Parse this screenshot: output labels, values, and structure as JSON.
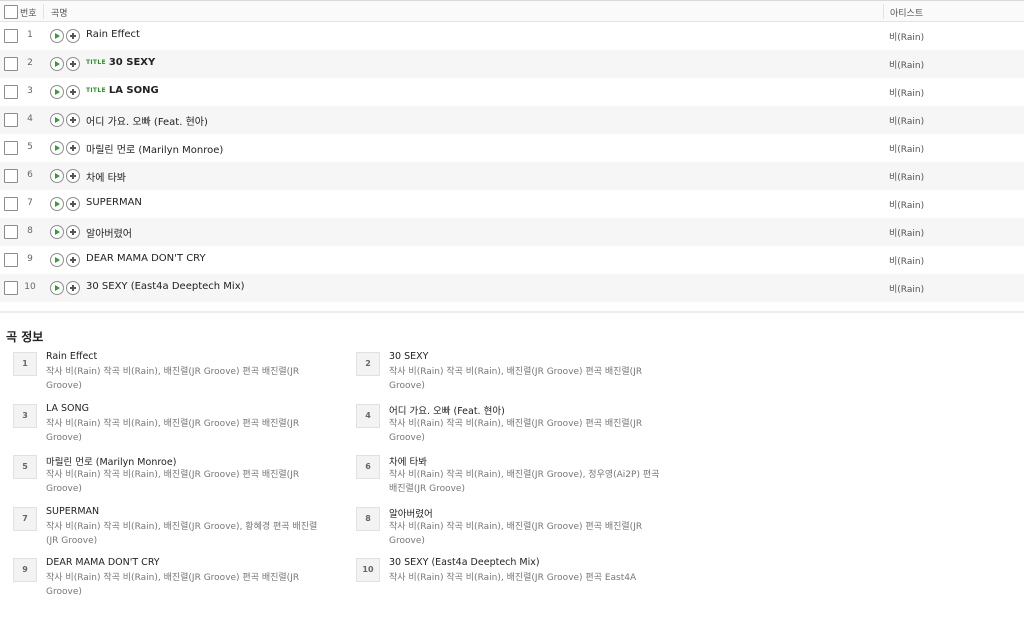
{
  "table": {
    "columns": {
      "number": "번호",
      "title": "곡명",
      "artist": "아티스트"
    },
    "title_badge": "TITLE",
    "tracks": [
      {
        "num": "1",
        "title": "Rain Effect",
        "artist": "비(Rain)",
        "is_title": false
      },
      {
        "num": "2",
        "title": "30 SEXY",
        "artist": "비(Rain)",
        "is_title": true
      },
      {
        "num": "3",
        "title": "LA SONG",
        "artist": "비(Rain)",
        "is_title": true
      },
      {
        "num": "4",
        "title": "어디 가요. 오빠 (Feat. 현아)",
        "artist": "비(Rain)",
        "is_title": false
      },
      {
        "num": "5",
        "title": "마릴린 먼로 (Marilyn Monroe)",
        "artist": "비(Rain)",
        "is_title": false
      },
      {
        "num": "6",
        "title": "차에 타봐",
        "artist": "비(Rain)",
        "is_title": false
      },
      {
        "num": "7",
        "title": "SUPERMAN",
        "artist": "비(Rain)",
        "is_title": false
      },
      {
        "num": "8",
        "title": "알아버렸어",
        "artist": "비(Rain)",
        "is_title": false
      },
      {
        "num": "9",
        "title": "DEAR MAMA DON'T CRY",
        "artist": "비(Rain)",
        "is_title": false
      },
      {
        "num": "10",
        "title": "30 SEXY (East4a Deeptech Mix)",
        "artist": "비(Rain)",
        "is_title": false
      }
    ]
  },
  "info": {
    "heading": "곡 정보",
    "items": [
      {
        "num": "1",
        "title": "Rain Effect",
        "credits": "작사  비(Rain)   작곡  비(Rain), 배진렬(JR Groove)   편곡  배진렬(JR Groove)"
      },
      {
        "num": "2",
        "title": "30 SEXY",
        "credits": "작사  비(Rain)   작곡  비(Rain), 배진렬(JR Groove)   편곡  배진렬(JR Groove)"
      },
      {
        "num": "3",
        "title": "LA SONG",
        "credits": "작사  비(Rain)   작곡  비(Rain), 배진렬(JR Groove)   편곡  배진렬(JR Groove)"
      },
      {
        "num": "4",
        "title": "어디 가요. 오빠 (Feat. 현아)",
        "credits": "작사  비(Rain)   작곡  비(Rain), 배진렬(JR Groove)   편곡  배진렬(JR Groove)"
      },
      {
        "num": "5",
        "title": "마릴린 먼로 (Marilyn Monroe)",
        "credits": "작사  비(Rain)   작곡  비(Rain), 배진렬(JR Groove)   편곡  배진렬(JR Groove)"
      },
      {
        "num": "6",
        "title": "차에 타봐",
        "credits": "작사  비(Rain)   작곡  비(Rain), 배진렬(JR Groove), 정우영(Ai2P)   편곡  배진렬(JR Groove)"
      },
      {
        "num": "7",
        "title": "SUPERMAN",
        "credits": "작사  비(Rain)   작곡  비(Rain), 배진렬(JR Groove), 황혜경   편곡  배진렬(JR Groove)"
      },
      {
        "num": "8",
        "title": "알아버렸어",
        "credits": "작사  비(Rain)   작곡  비(Rain), 배진렬(JR Groove)   편곡  배진렬(JR Groove)"
      },
      {
        "num": "9",
        "title": "DEAR MAMA DON'T CRY",
        "credits": "작사  비(Rain)   작곡  비(Rain), 배진렬(JR Groove)   편곡  배진렬(JR Groove)"
      },
      {
        "num": "10",
        "title": "30 SEXY (East4a Deeptech Mix)",
        "credits": "작사  비(Rain)   작곡  비(Rain), 배진렬(JR Groove)   편곡  East4A"
      }
    ]
  },
  "icons": {
    "play": "play-icon",
    "add": "add-icon",
    "checkbox": "checkbox"
  },
  "colors": {
    "play_accent": "#2ea12e",
    "title_badge": "#1f9a1f",
    "row_shade": "#f6f6f6"
  }
}
